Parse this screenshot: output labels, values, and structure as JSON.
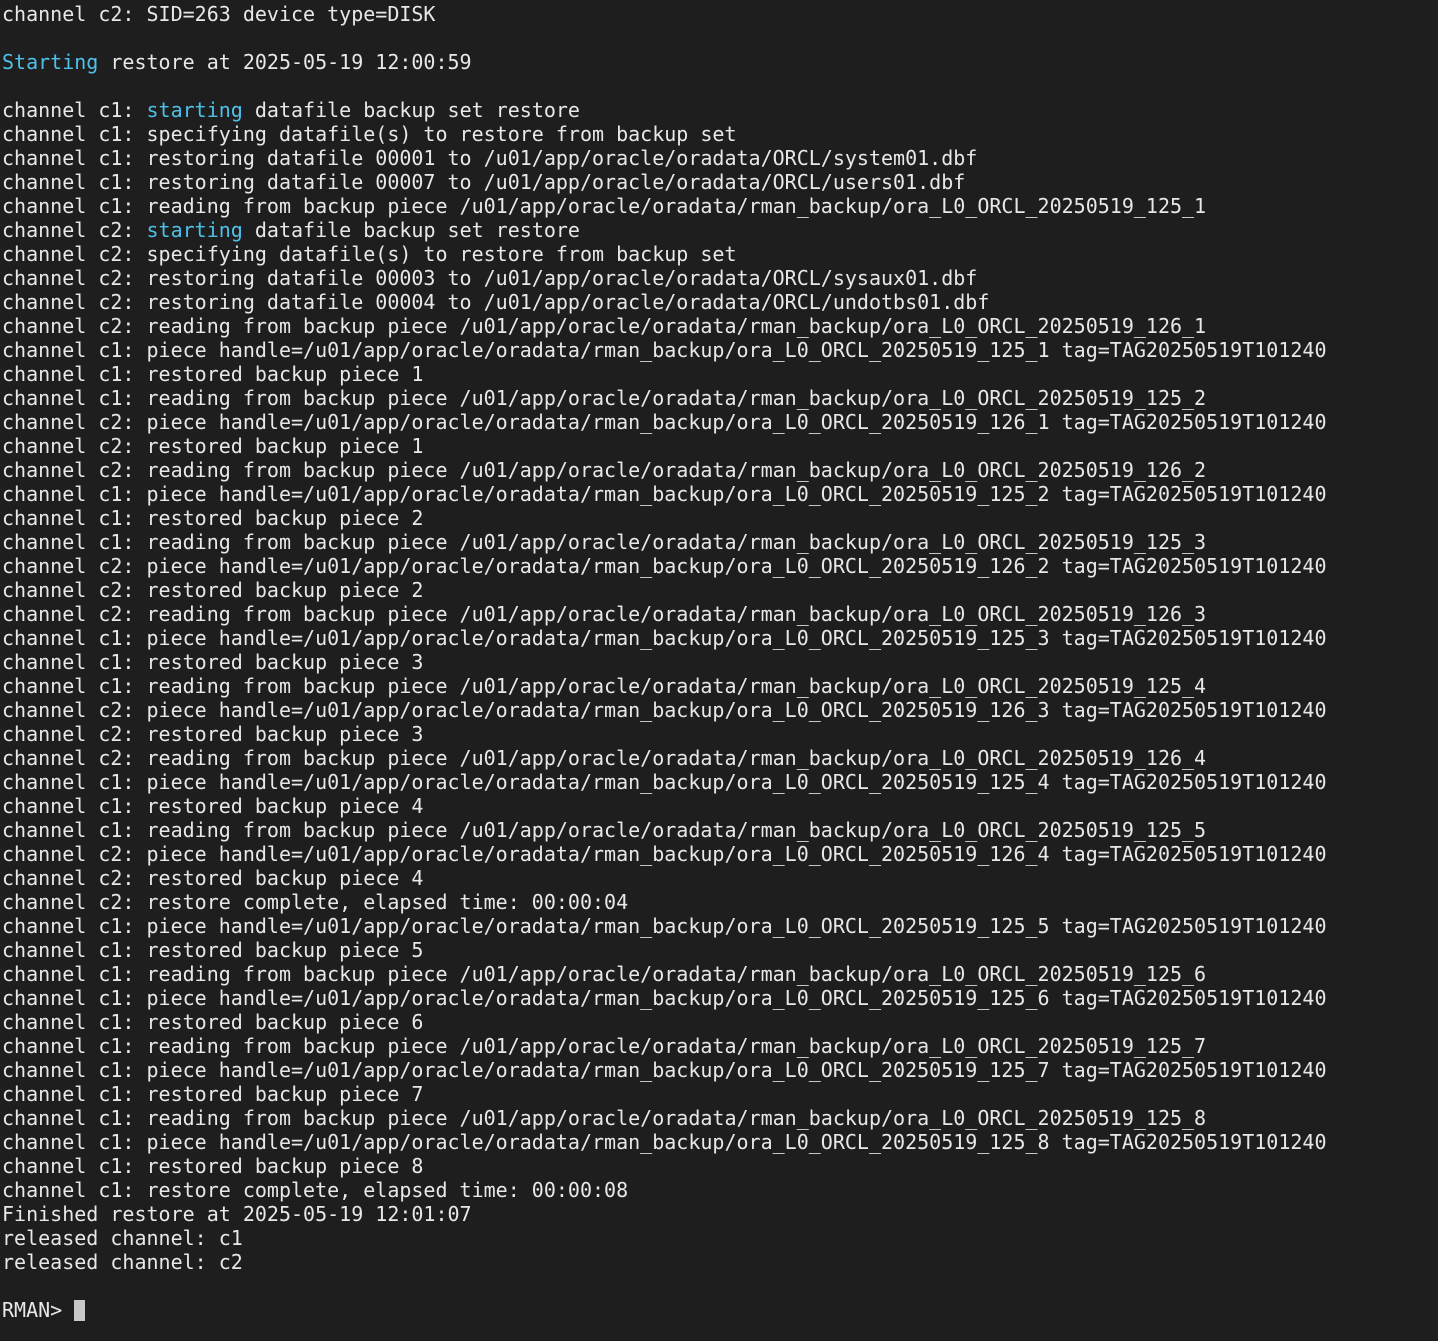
{
  "theme": {
    "background": "#1e1e1e",
    "foreground": "#e8e8e8",
    "highlight": "#4fc1e9",
    "cursor": "#c8c8c8"
  },
  "lines": [
    {
      "text": "channel c2: SID=263 device type=DISK"
    },
    {
      "text": ""
    },
    {
      "prefix": "",
      "hl": "Starting",
      "rest": " restore at 2025-05-19 12:00:59"
    },
    {
      "text": ""
    },
    {
      "prefix": "channel c1: ",
      "hl": "starting",
      "rest": " datafile backup set restore"
    },
    {
      "text": "channel c1: specifying datafile(s) to restore from backup set"
    },
    {
      "text": "channel c1: restoring datafile 00001 to /u01/app/oracle/oradata/ORCL/system01.dbf"
    },
    {
      "text": "channel c1: restoring datafile 00007 to /u01/app/oracle/oradata/ORCL/users01.dbf"
    },
    {
      "text": "channel c1: reading from backup piece /u01/app/oracle/oradata/rman_backup/ora_L0_ORCL_20250519_125_1"
    },
    {
      "prefix": "channel c2: ",
      "hl": "starting",
      "rest": " datafile backup set restore"
    },
    {
      "text": "channel c2: specifying datafile(s) to restore from backup set"
    },
    {
      "text": "channel c2: restoring datafile 00003 to /u01/app/oracle/oradata/ORCL/sysaux01.dbf"
    },
    {
      "text": "channel c2: restoring datafile 00004 to /u01/app/oracle/oradata/ORCL/undotbs01.dbf"
    },
    {
      "text": "channel c2: reading from backup piece /u01/app/oracle/oradata/rman_backup/ora_L0_ORCL_20250519_126_1"
    },
    {
      "text": "channel c1: piece handle=/u01/app/oracle/oradata/rman_backup/ora_L0_ORCL_20250519_125_1 tag=TAG20250519T101240"
    },
    {
      "text": "channel c1: restored backup piece 1"
    },
    {
      "text": "channel c1: reading from backup piece /u01/app/oracle/oradata/rman_backup/ora_L0_ORCL_20250519_125_2"
    },
    {
      "text": "channel c2: piece handle=/u01/app/oracle/oradata/rman_backup/ora_L0_ORCL_20250519_126_1 tag=TAG20250519T101240"
    },
    {
      "text": "channel c2: restored backup piece 1"
    },
    {
      "text": "channel c2: reading from backup piece /u01/app/oracle/oradata/rman_backup/ora_L0_ORCL_20250519_126_2"
    },
    {
      "text": "channel c1: piece handle=/u01/app/oracle/oradata/rman_backup/ora_L0_ORCL_20250519_125_2 tag=TAG20250519T101240"
    },
    {
      "text": "channel c1: restored backup piece 2"
    },
    {
      "text": "channel c1: reading from backup piece /u01/app/oracle/oradata/rman_backup/ora_L0_ORCL_20250519_125_3"
    },
    {
      "text": "channel c2: piece handle=/u01/app/oracle/oradata/rman_backup/ora_L0_ORCL_20250519_126_2 tag=TAG20250519T101240"
    },
    {
      "text": "channel c2: restored backup piece 2"
    },
    {
      "text": "channel c2: reading from backup piece /u01/app/oracle/oradata/rman_backup/ora_L0_ORCL_20250519_126_3"
    },
    {
      "text": "channel c1: piece handle=/u01/app/oracle/oradata/rman_backup/ora_L0_ORCL_20250519_125_3 tag=TAG20250519T101240"
    },
    {
      "text": "channel c1: restored backup piece 3"
    },
    {
      "text": "channel c1: reading from backup piece /u01/app/oracle/oradata/rman_backup/ora_L0_ORCL_20250519_125_4"
    },
    {
      "text": "channel c2: piece handle=/u01/app/oracle/oradata/rman_backup/ora_L0_ORCL_20250519_126_3 tag=TAG20250519T101240"
    },
    {
      "text": "channel c2: restored backup piece 3"
    },
    {
      "text": "channel c2: reading from backup piece /u01/app/oracle/oradata/rman_backup/ora_L0_ORCL_20250519_126_4"
    },
    {
      "text": "channel c1: piece handle=/u01/app/oracle/oradata/rman_backup/ora_L0_ORCL_20250519_125_4 tag=TAG20250519T101240"
    },
    {
      "text": "channel c1: restored backup piece 4"
    },
    {
      "text": "channel c1: reading from backup piece /u01/app/oracle/oradata/rman_backup/ora_L0_ORCL_20250519_125_5"
    },
    {
      "text": "channel c2: piece handle=/u01/app/oracle/oradata/rman_backup/ora_L0_ORCL_20250519_126_4 tag=TAG20250519T101240"
    },
    {
      "text": "channel c2: restored backup piece 4"
    },
    {
      "text": "channel c2: restore complete, elapsed time: 00:00:04"
    },
    {
      "text": "channel c1: piece handle=/u01/app/oracle/oradata/rman_backup/ora_L0_ORCL_20250519_125_5 tag=TAG20250519T101240"
    },
    {
      "text": "channel c1: restored backup piece 5"
    },
    {
      "text": "channel c1: reading from backup piece /u01/app/oracle/oradata/rman_backup/ora_L0_ORCL_20250519_125_6"
    },
    {
      "text": "channel c1: piece handle=/u01/app/oracle/oradata/rman_backup/ora_L0_ORCL_20250519_125_6 tag=TAG20250519T101240"
    },
    {
      "text": "channel c1: restored backup piece 6"
    },
    {
      "text": "channel c1: reading from backup piece /u01/app/oracle/oradata/rman_backup/ora_L0_ORCL_20250519_125_7"
    },
    {
      "text": "channel c1: piece handle=/u01/app/oracle/oradata/rman_backup/ora_L0_ORCL_20250519_125_7 tag=TAG20250519T101240"
    },
    {
      "text": "channel c1: restored backup piece 7"
    },
    {
      "text": "channel c1: reading from backup piece /u01/app/oracle/oradata/rman_backup/ora_L0_ORCL_20250519_125_8"
    },
    {
      "text": "channel c1: piece handle=/u01/app/oracle/oradata/rman_backup/ora_L0_ORCL_20250519_125_8 tag=TAG20250519T101240"
    },
    {
      "text": "channel c1: restored backup piece 8"
    },
    {
      "text": "channel c1: restore complete, elapsed time: 00:00:08"
    },
    {
      "text": "Finished restore at 2025-05-19 12:01:07"
    },
    {
      "text": "released channel: c1"
    },
    {
      "text": "released channel: c2"
    },
    {
      "text": ""
    }
  ],
  "prompt": "RMAN> "
}
